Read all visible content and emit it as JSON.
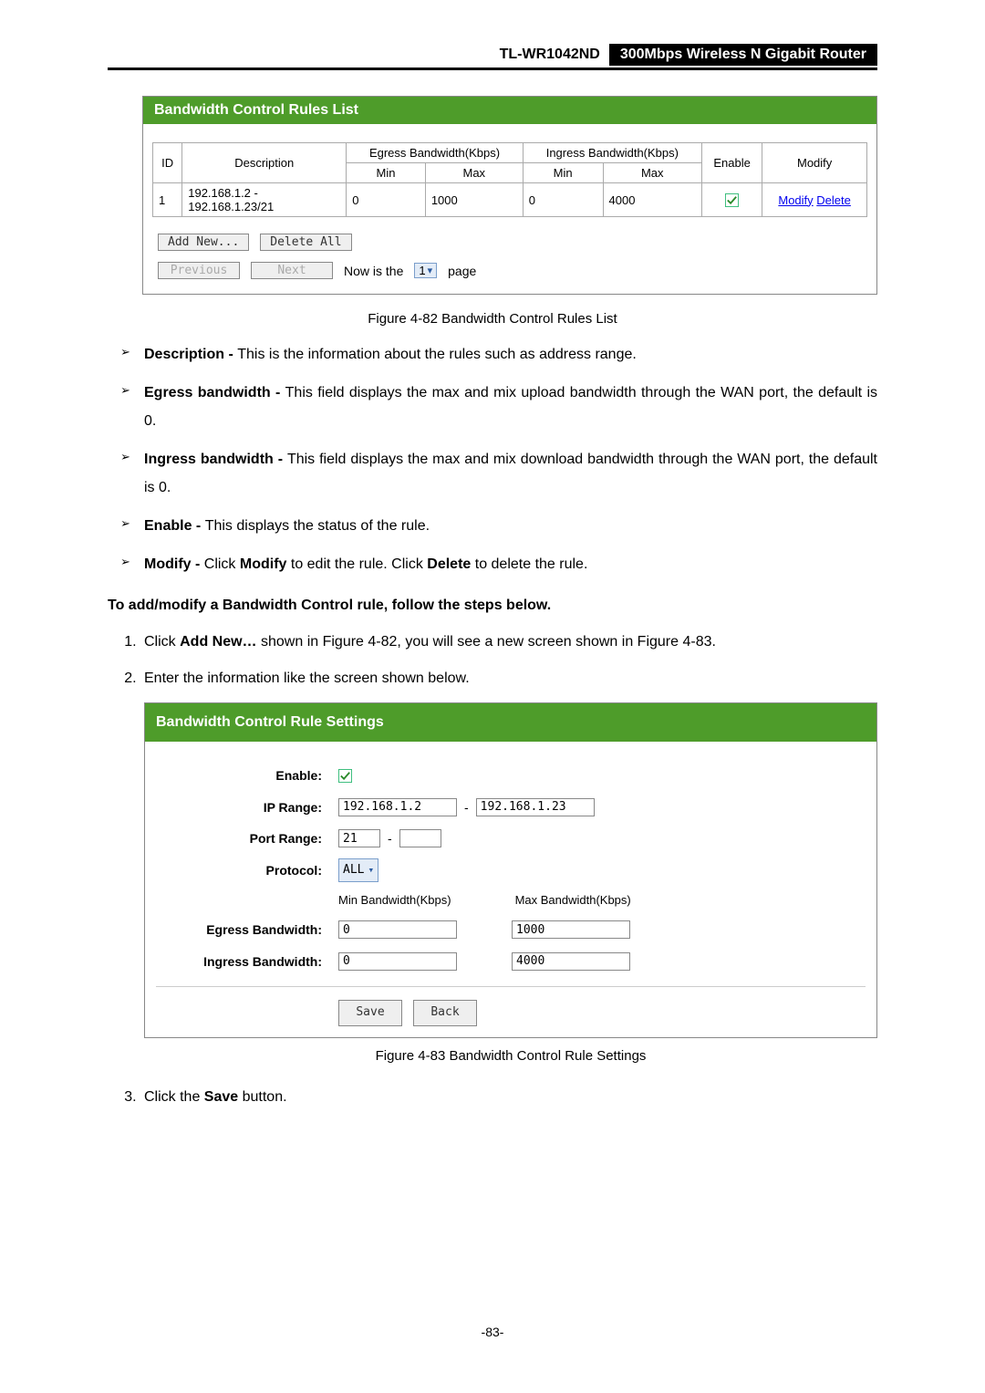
{
  "header": {
    "model": "TL-WR1042ND",
    "desc": "300Mbps Wireless N Gigabit Router"
  },
  "rules_panel": {
    "title": "Bandwidth Control Rules List",
    "columns": {
      "id": "ID",
      "description": "Description",
      "egress": "Egress Bandwidth(Kbps)",
      "ingress": "Ingress Bandwidth(Kbps)",
      "min": "Min",
      "max": "Max",
      "enable": "Enable",
      "modify": "Modify"
    },
    "row": {
      "id": "1",
      "desc": "192.168.1.2 - 192.168.1.23/21",
      "eg_min": "0",
      "eg_max": "1000",
      "in_min": "0",
      "in_max": "4000",
      "modify": "Modify",
      "delete": "Delete"
    },
    "btn_add": "Add New...",
    "btn_delete_all": "Delete All",
    "btn_prev": "Previous",
    "btn_next": "Next",
    "pager_pre": "Now is the",
    "pager_val": "1",
    "pager_post": "page"
  },
  "fig82": "Figure 4-82 Bandwidth Control Rules List",
  "bullets": {
    "desc_b": "Description - ",
    "desc_t": "This is the information about the rules such as address range.",
    "eg_b": "Egress bandwidth - ",
    "eg_t": "This field displays the max and mix upload bandwidth through the WAN port, the default is 0.",
    "in_b": "Ingress bandwidth - ",
    "in_t": "This field displays the max and mix download bandwidth through the WAN port, the default is 0.",
    "en_b": "Enable - ",
    "en_t": "This displays the status of the rule.",
    "mod_b": "Modify - ",
    "mod_t1": "Click ",
    "mod_t2": "Modify",
    "mod_t3": " to edit the rule. Click ",
    "mod_t4": "Delete",
    "mod_t5": " to delete the rule."
  },
  "intro": "To add/modify a Bandwidth Control rule, follow the steps below.",
  "steps": {
    "s1a": "Click ",
    "s1b": "Add New…",
    "s1c": " shown in Figure 4-82, you will see a new screen shown in Figure 4-83.",
    "s2": "Enter the information like the screen shown below.",
    "s3a": "Click the ",
    "s3b": "Save",
    "s3c": " button."
  },
  "settings": {
    "title": "Bandwidth Control Rule Settings",
    "labels": {
      "enable": "Enable:",
      "ip": "IP Range:",
      "port": "Port Range:",
      "proto": "Protocol:",
      "eg": "Egress Bandwidth:",
      "in": "Ingress Bandwidth:"
    },
    "values": {
      "ip1": "192.168.1.2",
      "ip2": "192.168.1.23",
      "port1": "21",
      "proto": "ALL",
      "min_h": "Min Bandwidth(Kbps)",
      "max_h": "Max Bandwidth(Kbps)",
      "eg_min": "0",
      "eg_max": "1000",
      "in_min": "0",
      "in_max": "4000"
    },
    "btn_save": "Save",
    "btn_back": "Back"
  },
  "fig83": "Figure 4-83 Bandwidth Control Rule Settings",
  "page_num": "-83-"
}
